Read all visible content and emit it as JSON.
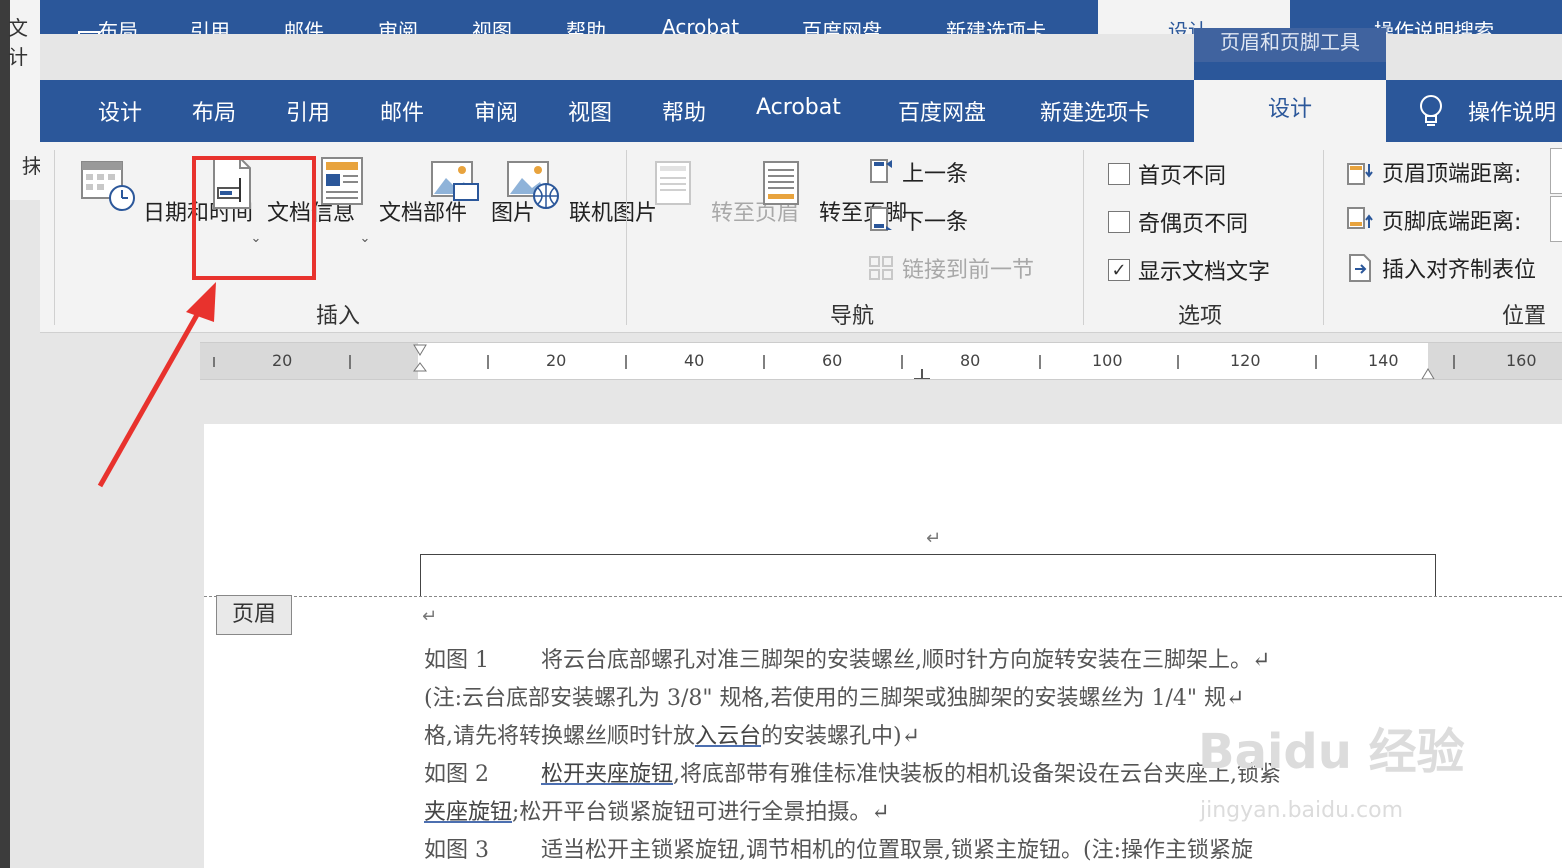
{
  "ghost_tabs": [
    "布局",
    "引用",
    "邮件",
    "审阅",
    "视图",
    "帮助",
    "Acrobat",
    "百度网盘",
    "新建选项卡",
    "设计",
    "操作说明搜索"
  ],
  "ghost_ctx_label": "页眉和页脚工具",
  "left_fragments": {
    "top": "文计",
    "mid": "抹"
  },
  "tabs": [
    "设计",
    "布局",
    "引用",
    "邮件",
    "审阅",
    "视图",
    "帮助",
    "Acrobat",
    "百度网盘",
    "新建选项卡"
  ],
  "active_tab": "设计",
  "tell_me": "操作说明",
  "insert_group": {
    "label": "插入",
    "buttons": [
      "日期和时间",
      "文档信息",
      "文档部件",
      "图片",
      "联机图片"
    ]
  },
  "nav_group": {
    "label": "导航",
    "goto_header": "转至页眉",
    "goto_footer": "转至页脚",
    "previous": "上一条",
    "next": "下一条",
    "link_previous": "链接到前一节"
  },
  "options_group": {
    "label": "选项",
    "different_first": "首页不同",
    "different_odd_even": "奇偶页不同",
    "show_doc_text": "显示文档文字",
    "show_doc_text_checked": true
  },
  "position_group": {
    "label": "位置",
    "header_top": "页眉顶端距离:",
    "footer_bottom": "页脚底端距离:",
    "insert_align_tab": "插入对齐制表位"
  },
  "ruler_labels": [
    "20",
    "20",
    "40",
    "60",
    "80",
    "100",
    "120",
    "140",
    "160"
  ],
  "header_tag": "页眉",
  "doc_lines": {
    "l1_label": "如图 1",
    "l1_text": "将云台底部螺孔对准三脚架的安装螺丝,顺时针方向旋转安装在三脚架上。↵",
    "l2": "(注:云台底部安装螺孔为 3/8\" 规格,若使用的三脚架或独脚架的安装螺丝为 1/4\" 规↵",
    "l3_a": "格,请先将转换螺丝顺时针放",
    "l3_link": "入云台",
    "l3_b": "的安装螺孔中)↵",
    "l4_label": "如图 2",
    "l4_link": "松开夹座旋钮",
    "l4_text": ",将底部带有雅佳标准快装板的相机设备架设在云台夹座上,锁紧",
    "l5_link": "夹座旋钮",
    "l5_text": ";松开平台锁紧旋钮可进行全景拍摄。↵",
    "l6_label": "如图 3",
    "l6_text": "适当松开主锁紧旋钮,调节相机的位置取景,锁紧主旋钮。(注:操作主锁紧旋"
  },
  "watermark": {
    "text": "Baidu 经验",
    "url": "jingyan.baidu.com"
  }
}
